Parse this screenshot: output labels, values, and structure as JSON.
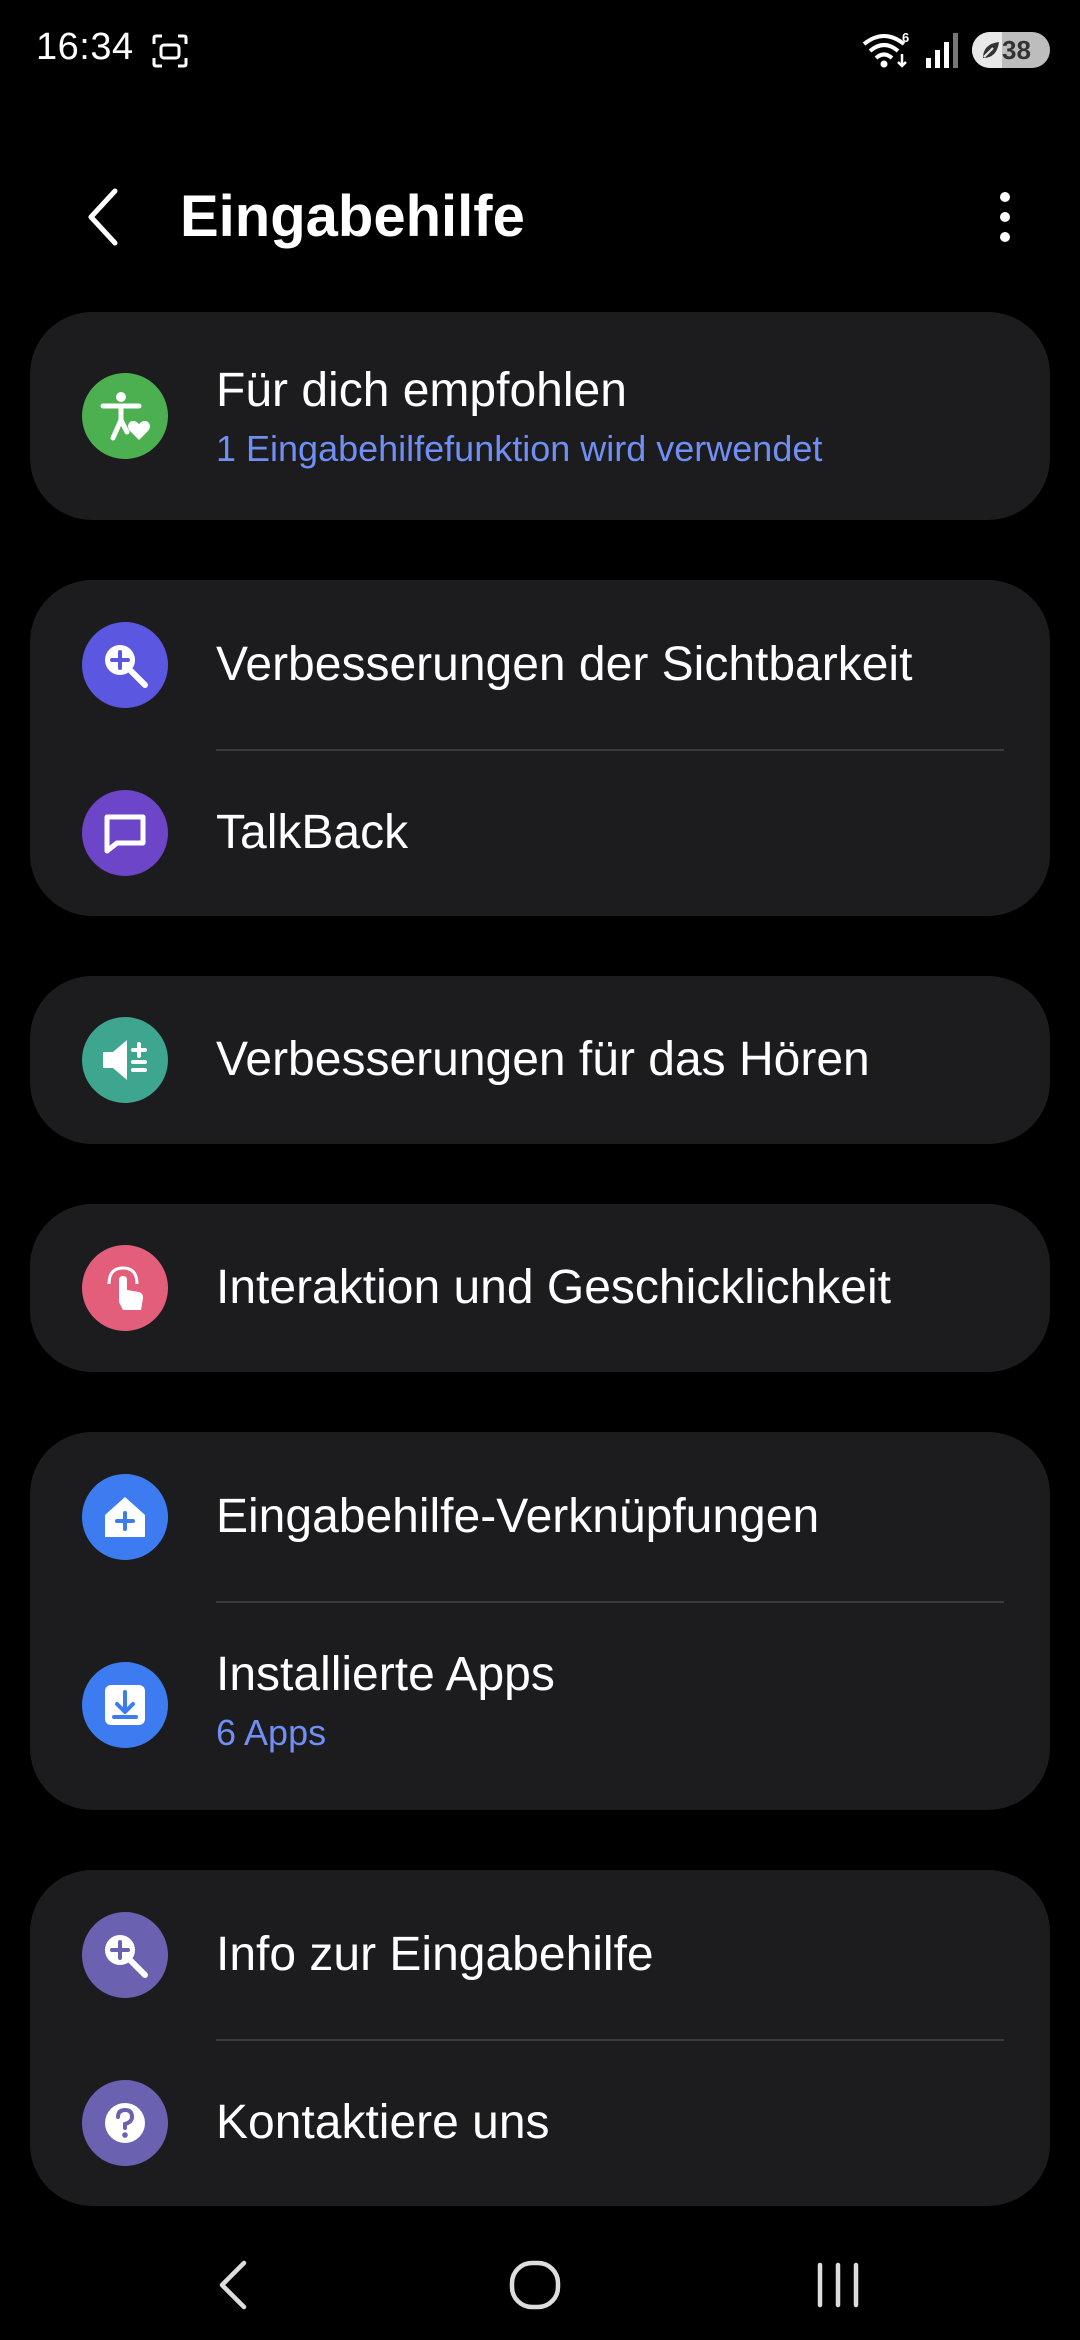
{
  "status_bar": {
    "time": "16:34",
    "wifi_badge": "6",
    "battery_level": "38",
    "battery_fraction": 0.38
  },
  "header": {
    "title": "Eingabehilfe"
  },
  "colors": {
    "background": "#000000",
    "card": "#1c1c1e",
    "subtitle": "#6f8ff5",
    "icon_green": "#4caf50",
    "icon_indigo": "#5b57e0",
    "icon_purple": "#6c45c9",
    "icon_teal": "#3ea58e",
    "icon_pink": "#e35e7a",
    "icon_blue": "#3d7cf0",
    "icon_lavender": "#6a62b0"
  },
  "sections": [
    {
      "items": [
        {
          "title": "Für dich empfohlen",
          "subtitle": "1 Eingabehilfefunktion wird verwendet",
          "icon": "accessibility-heart-icon"
        }
      ]
    },
    {
      "items": [
        {
          "title": "Verbesserungen der Sichtbarkeit",
          "icon": "magnifier-plus-icon"
        },
        {
          "title": "TalkBack",
          "icon": "chat-bubble-icon"
        }
      ]
    },
    {
      "items": [
        {
          "title": "Verbesserungen für das Hören",
          "icon": "speaker-plus-icon"
        }
      ]
    },
    {
      "items": [
        {
          "title": "Interaktion und Geschicklichkeit",
          "icon": "touch-hand-icon"
        }
      ]
    },
    {
      "items": [
        {
          "title": "Eingabehilfe-Verknüpfungen",
          "icon": "home-plus-icon"
        },
        {
          "title": "Installierte Apps",
          "subtitle": "6 Apps",
          "icon": "download-tray-icon"
        }
      ]
    },
    {
      "items": [
        {
          "title": "Info zur Eingabehilfe",
          "icon": "info-magnifier-icon"
        },
        {
          "title": "Kontaktiere uns",
          "icon": "question-mark-icon"
        }
      ]
    }
  ],
  "nav_bar": {
    "back": "back-nav-icon",
    "home": "home-nav-icon",
    "recents": "recents-nav-icon"
  }
}
